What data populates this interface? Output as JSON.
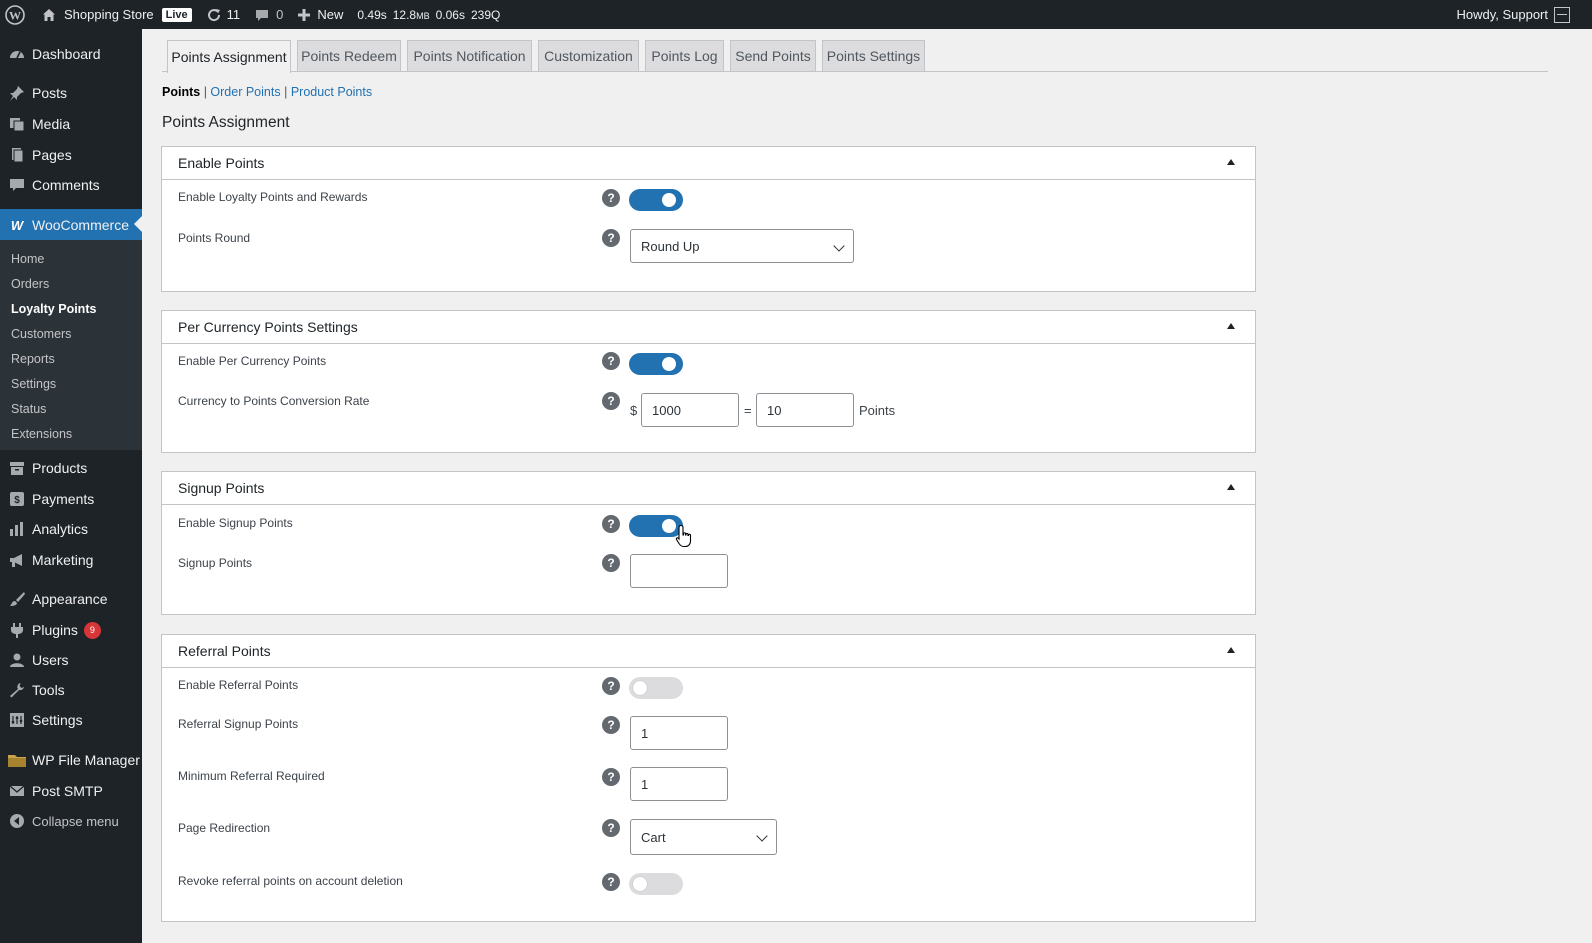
{
  "adminbar": {
    "site_name": "Shopping Store",
    "live_badge": "Live",
    "updates_count": "11",
    "comments_count": "0",
    "new_label": "New",
    "perf_time": "0.49s",
    "perf_memory": "12.8",
    "perf_memory_unit": "MB",
    "perf_query_time": "0.06s",
    "perf_queries": "239Q",
    "howdy": "Howdy, Support"
  },
  "sidebar": {
    "dashboard": "Dashboard",
    "posts": "Posts",
    "media": "Media",
    "pages": "Pages",
    "comments": "Comments",
    "woocommerce": "WooCommerce",
    "sub": [
      "Home",
      "Orders",
      "Loyalty Points",
      "Customers",
      "Reports",
      "Settings",
      "Status",
      "Extensions"
    ],
    "products": "Products",
    "payments": "Payments",
    "analytics": "Analytics",
    "marketing": "Marketing",
    "appearance": "Appearance",
    "plugins": "Plugins",
    "plugins_badge": "9",
    "users": "Users",
    "tools": "Tools",
    "settings": "Settings",
    "wp_file_manager": "WP File Manager",
    "post_smtp": "Post SMTP",
    "collapse": "Collapse menu"
  },
  "tabs": [
    "Points Assignment",
    "Points Redeem",
    "Points Notification",
    "Customization",
    "Points Log",
    "Send Points",
    "Points Settings"
  ],
  "subsub": {
    "points": "Points",
    "order_points": "Order Points",
    "product_points": "Product Points",
    "sep": "|"
  },
  "page_title": "Points Assignment",
  "help_glyph": "?",
  "sections": {
    "enable_points": {
      "title": "Enable Points",
      "enable_label": "Enable Loyalty Points and Rewards",
      "enable_on": true,
      "round_label": "Points Round",
      "round_value": "Round Up"
    },
    "per_currency": {
      "title": "Per Currency Points Settings",
      "enable_label": "Enable Per Currency Points",
      "enable_on": true,
      "rate_label": "Currency to Points Conversion Rate",
      "currency_symbol": "$",
      "currency_amount": "1000",
      "equals": "=",
      "points_amount": "10",
      "points_unit": "Points"
    },
    "signup": {
      "title": "Signup Points",
      "enable_label": "Enable Signup Points",
      "enable_on": true,
      "points_label": "Signup Points",
      "points_value": ""
    },
    "referral": {
      "title": "Referral Points",
      "enable_label": "Enable Referral Points",
      "enable_on": false,
      "signup_label": "Referral Signup Points",
      "signup_value": "1",
      "min_label": "Minimum Referral Required",
      "min_value": "1",
      "redirect_label": "Page Redirection",
      "redirect_value": "Cart",
      "revoke_label": "Revoke referral points on account deletion",
      "revoke_on": false
    }
  },
  "colors": {
    "accent": "#2271b1",
    "sidebar_bg": "#1d2327",
    "submenu_bg": "#2c3338",
    "badge_red": "#d63638"
  }
}
